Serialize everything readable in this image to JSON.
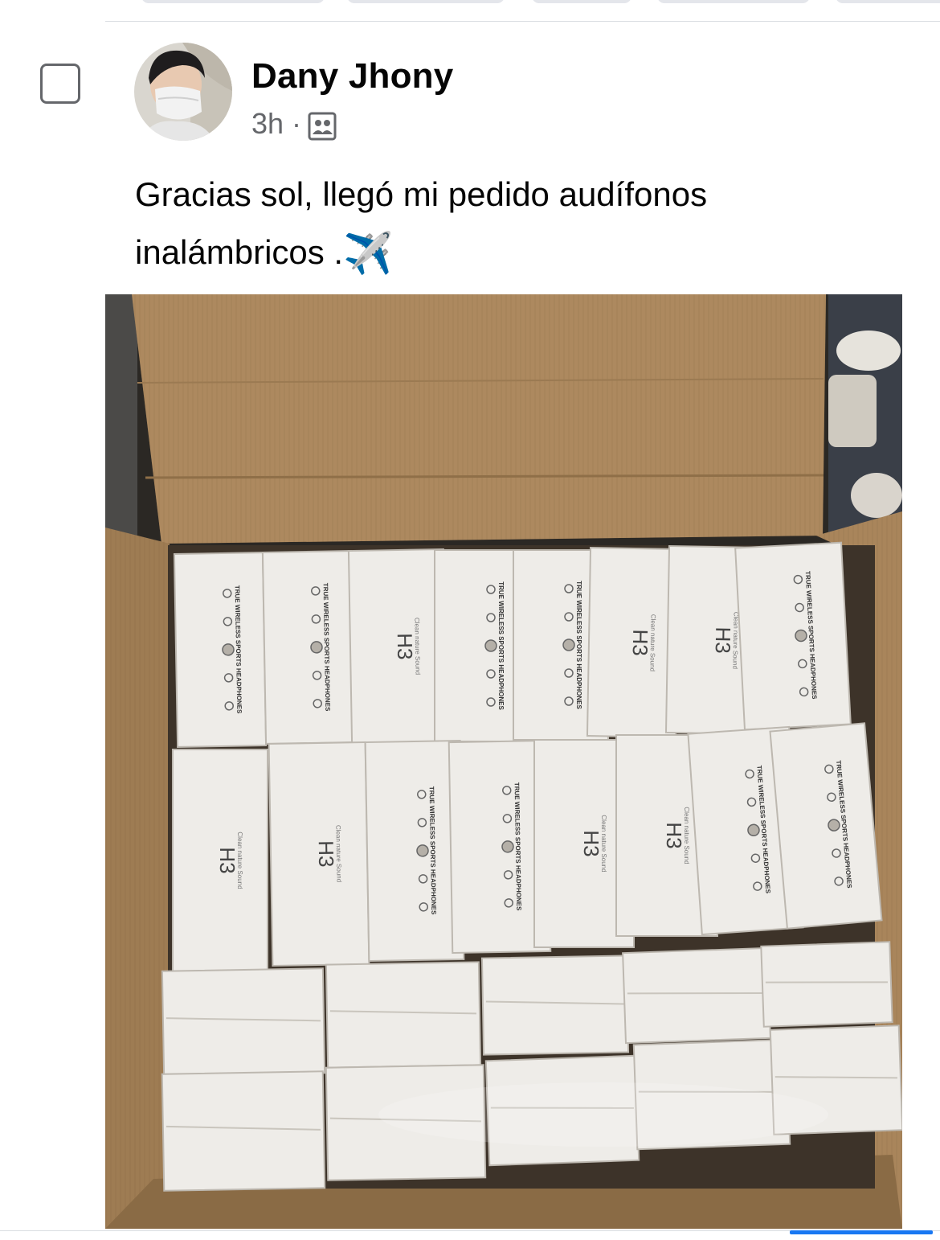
{
  "post": {
    "author": "Dany Jhony",
    "time": "3h",
    "separator": "·",
    "audience_icon": "group-audience-icon",
    "caption": "Gracias sol, llegó mi pedido audífonos inalámbricos .",
    "caption_emoji": "✈️"
  },
  "photo": {
    "box_spine_texts": {
      "brand": "H3",
      "tagline": "Clean nature Sound",
      "title": "TRUE WIRELESS SPORTS HEADPHONES"
    }
  },
  "colors": {
    "accent": "#1877f2",
    "secondary_text": "#65676b",
    "cardboard": "#a8865e"
  }
}
